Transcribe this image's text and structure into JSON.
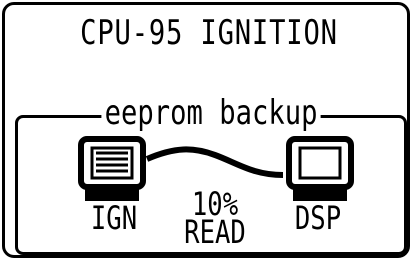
{
  "screen": {
    "title": "CPU-95 IGNITION",
    "panel_label": "eeprom backup",
    "source_device": "IGN",
    "target_device": "DSP",
    "progress_text": "10%",
    "progress_value": 10,
    "status_text": "READ",
    "icons": {
      "source": "ignition-unit-icon",
      "target": "display-unit-icon",
      "link": "cable-link-icon"
    }
  }
}
